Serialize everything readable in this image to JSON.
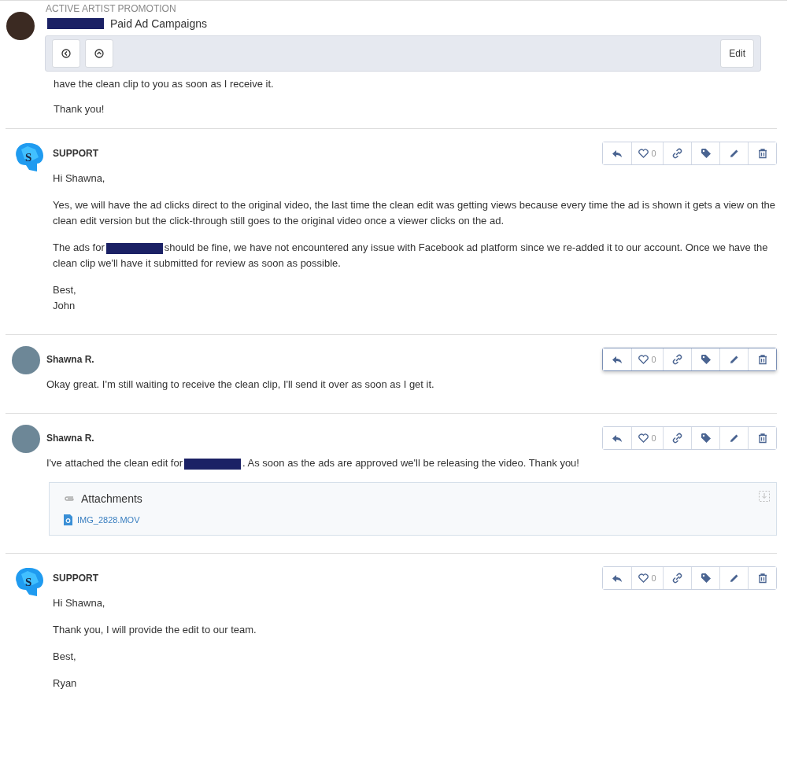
{
  "header": {
    "category": "ACTIVE ARTIST PROMOTION",
    "title": [
      {
        "kind": "redaction"
      },
      {
        "kind": "text",
        "text": "Paid Ad Campaigns"
      }
    ],
    "edit_button": "Edit"
  },
  "previous_message": {
    "paragraphs": [
      [
        {
          "kind": "text",
          "text": "have the clean clip to you as soon as I receive it."
        }
      ],
      [
        {
          "kind": "text",
          "text": "Thank you!"
        }
      ]
    ]
  },
  "messages": [
    {
      "author": "SUPPORT",
      "avatar": {
        "kind": "logo",
        "letter": "S"
      },
      "selected": false,
      "likes": "0",
      "paragraphs": [
        [
          {
            "kind": "text",
            "text": "Hi Shawna,"
          }
        ],
        [
          {
            "kind": "text",
            "text": "Yes, we will have the ad clicks direct to the original video, the last time the clean edit was getting views because every time the ad is shown it gets a view on the clean edit version but the click-through still goes to the original video once a viewer clicks on the ad."
          }
        ],
        [
          {
            "kind": "text",
            "text": "The ads for"
          },
          {
            "kind": "redaction"
          },
          {
            "kind": "text",
            "text": "should be fine, we have not encountered any issue with Facebook ad platform since we re-added it to our account. Once we have the clean clip we'll have it submitted for review as soon as possible."
          }
        ],
        [
          {
            "kind": "text",
            "text": "Best,"
          },
          {
            "kind": "break"
          },
          {
            "kind": "text",
            "text": "John"
          }
        ]
      ]
    },
    {
      "author": "Shawna R.",
      "avatar": {
        "kind": "photo"
      },
      "selected": true,
      "likes": "0",
      "paragraphs": [
        [
          {
            "kind": "text",
            "text": "Okay great. I'm still waiting to receive the clean clip, I'll send it over as soon as I get it."
          }
        ]
      ]
    },
    {
      "author": "Shawna R.",
      "avatar": {
        "kind": "photo"
      },
      "selected": false,
      "likes": "0",
      "paragraphs": [
        [
          {
            "kind": "text",
            "text": "I've attached the clean edit for"
          },
          {
            "kind": "redaction"
          },
          {
            "kind": "text",
            "text": ". As soon as the ads are approved we'll be releasing the video. Thank you!"
          }
        ]
      ],
      "attachments": {
        "title": "Attachments",
        "files": [
          "IMG_2828.MOV"
        ]
      }
    },
    {
      "author": "SUPPORT",
      "avatar": {
        "kind": "logo",
        "letter": "S"
      },
      "selected": false,
      "likes": "0",
      "paragraphs": [
        [
          {
            "kind": "text",
            "text": "Hi Shawna,"
          }
        ],
        [
          {
            "kind": "text",
            "text": "Thank you, I will provide the edit to our team."
          }
        ],
        [
          {
            "kind": "text",
            "text": "Best,"
          }
        ],
        [
          {
            "kind": "text",
            "text": "Ryan"
          }
        ]
      ]
    }
  ]
}
